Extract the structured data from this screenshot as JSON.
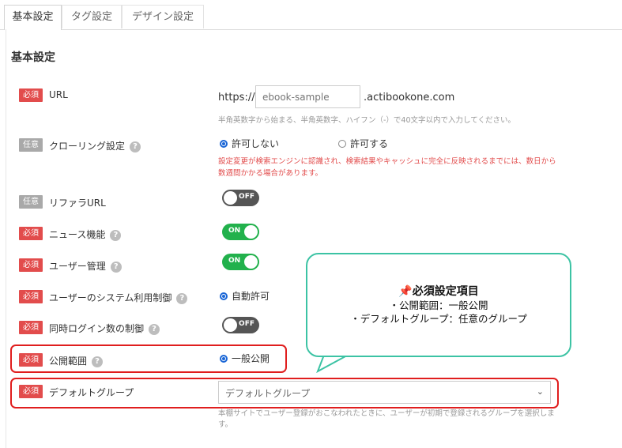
{
  "tabs": [
    {
      "label": "基本設定",
      "active": true
    },
    {
      "label": "タグ設定",
      "active": false
    },
    {
      "label": "デザイン設定",
      "active": false
    }
  ],
  "section_title": "基本設定",
  "badges": {
    "required": "必須",
    "optional": "任意"
  },
  "help_glyph": "?",
  "rows": {
    "url": {
      "label": "URL",
      "prefix": "https://",
      "placeholder": "ebook-sample",
      "suffix": ".actibookone.com",
      "hint": "半角英数字から始まる、半角英数字、ハイフン（-）で40文字以内で入力してください。"
    },
    "crawling": {
      "label": "クローリング設定",
      "option_no": "許可しない",
      "option_yes": "許可する",
      "warning": "設定変更が検索エンジンに認識され、検索結果やキャッシュに完全に反映されるまでには、数日から数週間かかる場合があります。"
    },
    "referrer": {
      "label": "リファラURL",
      "toggle": "OFF"
    },
    "news": {
      "label": "ニュース機能",
      "toggle": "ON"
    },
    "user_mgmt": {
      "label": "ユーザー管理",
      "toggle": "ON"
    },
    "system_use": {
      "label": "ユーザーのシステム利用制御",
      "option": "自動許可"
    },
    "concurrent": {
      "label": "同時ログイン数の制御",
      "toggle": "OFF"
    },
    "visibility": {
      "label": "公開範囲",
      "option": "一般公開"
    },
    "default_group": {
      "label": "デフォルトグループ",
      "selected": "デフォルトグループ",
      "hint": "本棚サイトでユーザー登録がおこなわれたときに、ユーザーが初期で登録されるグループを選択します。"
    }
  },
  "callout": {
    "pin": "📌",
    "title": "必須設定項目",
    "lines": [
      "・公開範囲：一般公開",
      "・デフォルトグループ：任意のグループ"
    ]
  },
  "colors": {
    "required": "#e24c4c",
    "optional": "#a9a9a9",
    "toggle_on": "#22b14c",
    "toggle_off": "#555555",
    "highlight": "#e01e1e",
    "callout_border": "#3cc3a4",
    "radio": "#1a66d6"
  }
}
